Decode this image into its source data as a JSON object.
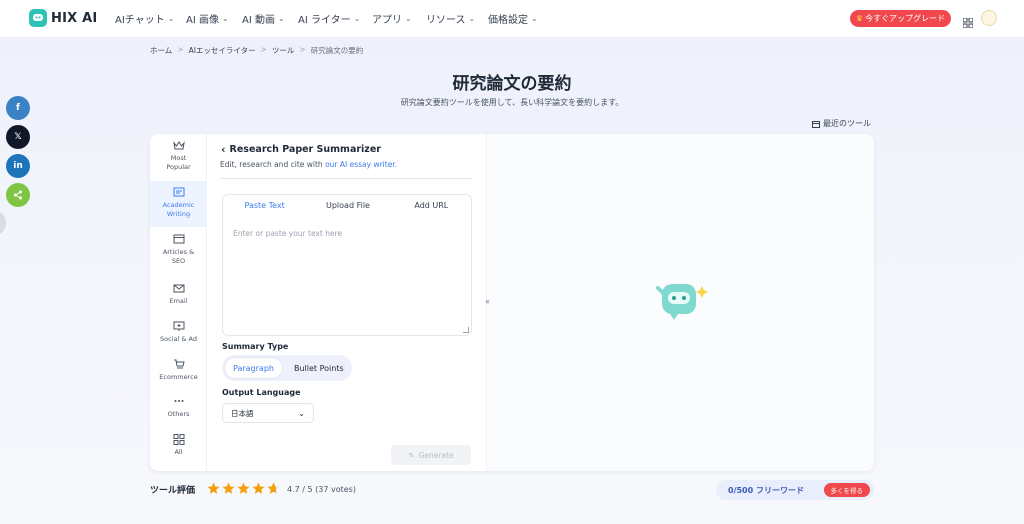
{
  "brand": {
    "name": "HIX AI",
    "accent": "#2cc3b5"
  },
  "nav": {
    "items": [
      {
        "label": "AIチャット"
      },
      {
        "label": "AI 画像"
      },
      {
        "label": "AI 動画"
      },
      {
        "label": "AI ライター"
      },
      {
        "label": "アプリ"
      },
      {
        "label": "リソース"
      },
      {
        "label": "価格設定"
      }
    ],
    "upgrade_label": "今すぐアップグレード"
  },
  "breadcrumb": [
    "ホーム",
    "AIエッセイライター",
    "ツール",
    "研究論文の要約"
  ],
  "page": {
    "title": "研究論文の要約",
    "subtitle": "研究論文要約ツールを使用して、長い科学論文を要約します。",
    "recent_tools": "最近のツール"
  },
  "share": [
    "facebook-icon",
    "x-icon",
    "linkedin-icon",
    "share-icon"
  ],
  "categories": [
    {
      "label1": "Most",
      "label2": "Popular",
      "icon": "crown-icon"
    },
    {
      "label1": "Academic",
      "label2": "Writing",
      "icon": "academic-icon",
      "active": true
    },
    {
      "label1": "Articles &",
      "label2": "SEO",
      "icon": "article-icon"
    },
    {
      "label1": "Email",
      "label2": "",
      "icon": "mail-icon"
    },
    {
      "label1": "Social & Ad",
      "label2": "",
      "icon": "social-icon"
    },
    {
      "label1": "Ecommerce",
      "label2": "",
      "icon": "cart-icon"
    },
    {
      "label1": "Others",
      "label2": "",
      "icon": "more-icon"
    },
    {
      "label1": "All",
      "label2": "",
      "icon": "grid-icon"
    }
  ],
  "tool": {
    "title": "Research Paper Summarizer",
    "desc_prefix": "Edit, research and cite with ",
    "desc_link": "our AI essay writer.",
    "tabs": [
      "Paste Text",
      "Upload File",
      "Add URL"
    ],
    "input_placeholder": "Enter or paste your text here",
    "summary_type_label": "Summary Type",
    "summary_types": [
      "Paragraph",
      "Bullet Points"
    ],
    "output_language_label": "Output Language",
    "output_language_value": "日本語",
    "generate_label": "Generate"
  },
  "rating": {
    "label": "ツール評価",
    "stars": 4.7,
    "score_text": "4.7 / 5 (37 votes)"
  },
  "quota": {
    "text": "0/500 フリーワード",
    "button": "多くを得る"
  },
  "colors": {
    "primary": "#3b7cf0",
    "danger": "#f0484d",
    "star": "#f59e0b"
  }
}
